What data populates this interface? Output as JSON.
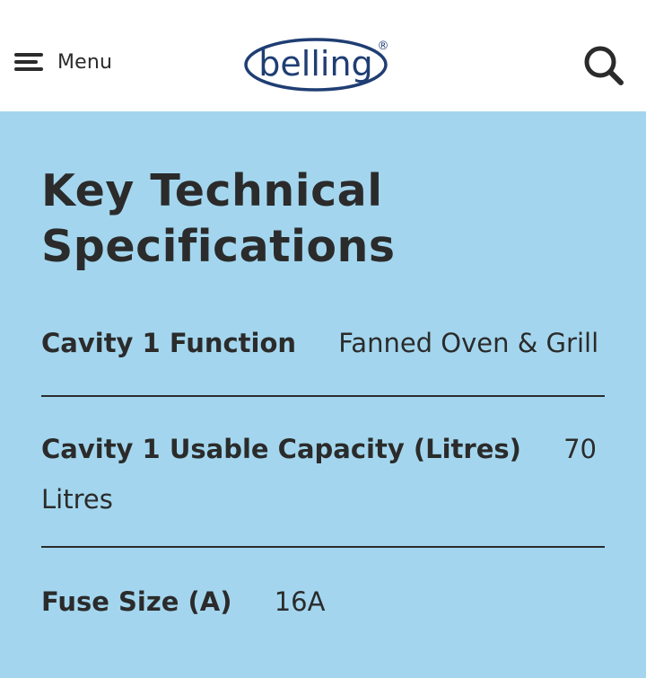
{
  "header": {
    "menu_label": "Menu",
    "logo_text": "belling",
    "logo_mark": "®",
    "logo_color": "#1f3e73",
    "menu_icon": "hamburger-icon",
    "search_icon": "search-icon"
  },
  "page": {
    "background": "#a3d6ee",
    "title_line1": "Key Technical",
    "title_line2": "Specifications"
  },
  "specs": [
    {
      "label": "Cavity 1 Function",
      "value": "Fanned Oven & Grill"
    },
    {
      "label": "Cavity 1 Usable Capacity (Litres)",
      "value": "70 Litres"
    },
    {
      "label": "Fuse Size (A)",
      "value": "16A"
    }
  ]
}
